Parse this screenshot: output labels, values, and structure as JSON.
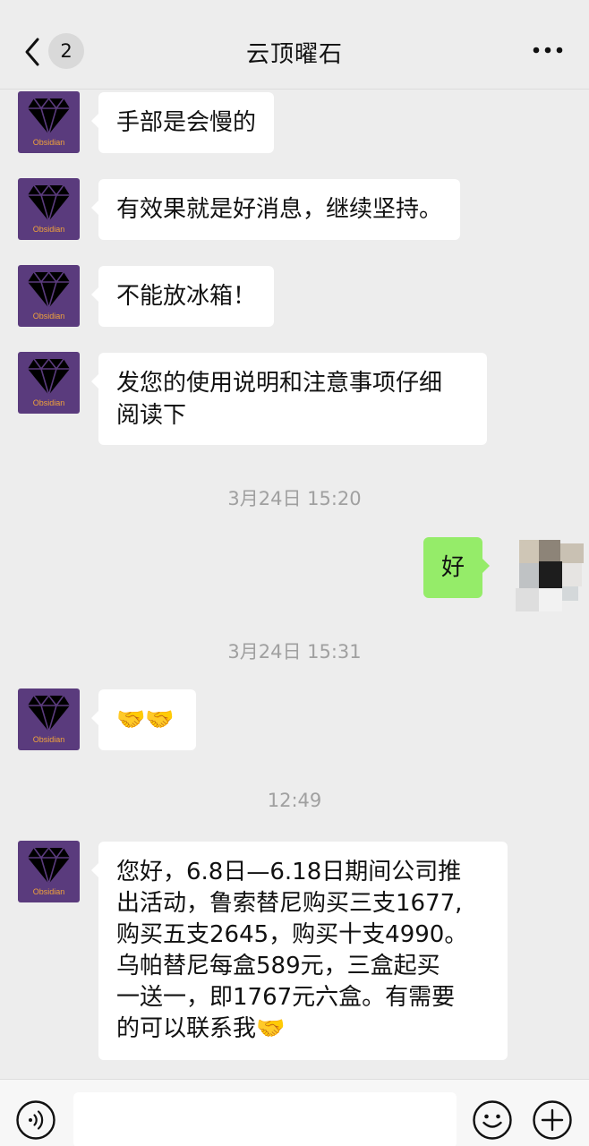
{
  "header": {
    "title": "云顶曜石",
    "unread_count": "2"
  },
  "contact": {
    "avatar_brand": "Obsidian",
    "avatar_colors": {
      "background": "#5a3b7d",
      "diamond": "#000000",
      "brand_text": "#f0a23b"
    }
  },
  "messages": [
    {
      "text": "手部是会慢的"
    },
    {
      "text": "有效果就是好消息，继续坚持。"
    },
    {
      "text": "不能放冰箱！"
    },
    {
      "line1": "发您的使用说明和注意事项仔细",
      "line2": "阅读下"
    },
    {
      "text": "好"
    },
    {
      "text": "🤝🤝"
    },
    {
      "lines": [
        "您好，6.8日—6.18日期间公司推",
        "出活动，鲁索替尼购买三支1677,",
        "购买五支2645，购买十支4990。",
        "乌帕替尼每盒589元，三盒起买",
        "一送一，即1767元六盒。有需要",
        "的可以联系我🤝"
      ]
    }
  ],
  "timestamps": [
    "3月24日 15:20",
    "3月24日 15:31",
    "12:49"
  ],
  "colors": {
    "background": "#ededed",
    "my_bubble": "#95ec69",
    "their_bubble": "#ffffff"
  },
  "icons": {
    "back": "chevron-left-icon",
    "more": "more-dots-icon",
    "voice": "voice-icon",
    "emoji": "emoji-icon",
    "plus": "plus-icon"
  }
}
